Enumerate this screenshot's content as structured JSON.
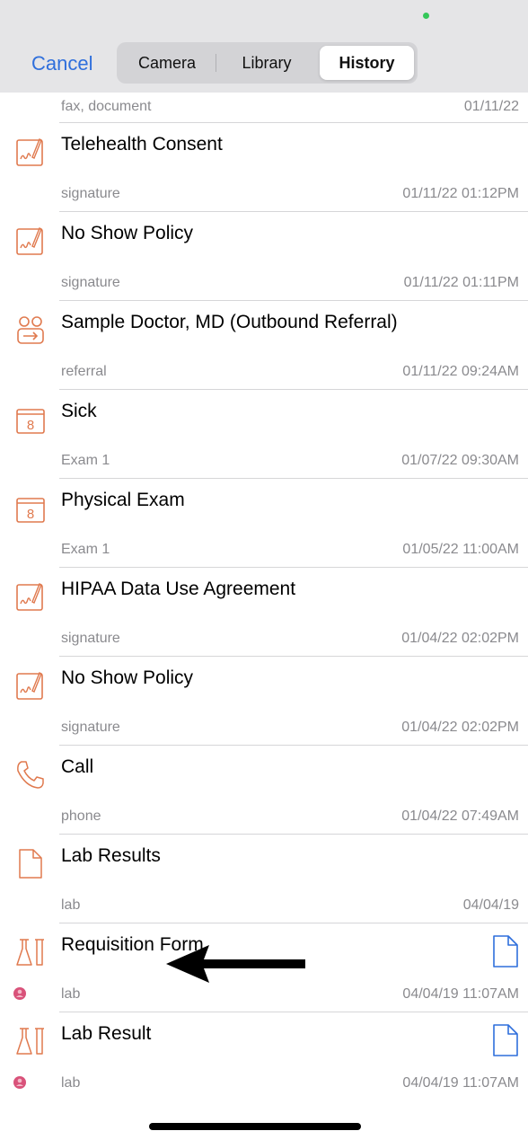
{
  "header": {
    "cancel_label": "Cancel",
    "tabs": [
      {
        "label": "Camera",
        "selected": false
      },
      {
        "label": "Library",
        "selected": false
      },
      {
        "label": "History",
        "selected": true
      }
    ]
  },
  "top_partial": {
    "subtitle": "fax, document",
    "date": "01/11/22"
  },
  "items": [
    {
      "title": "Telehealth Consent",
      "subtitle": "signature",
      "date": "01/11/22 01:12PM",
      "icon": "signature-icon"
    },
    {
      "title": "No Show Policy",
      "subtitle": "signature",
      "date": "01/11/22 01:11PM",
      "icon": "signature-icon"
    },
    {
      "title": "Sample Doctor, MD (Outbound Referral)",
      "subtitle": "referral",
      "date": "01/11/22 09:24AM",
      "icon": "referral-icon"
    },
    {
      "title": "Sick",
      "subtitle": "Exam 1",
      "date": "01/07/22 09:30AM",
      "icon": "calendar-icon",
      "calendar_day": "8"
    },
    {
      "title": "Physical Exam",
      "subtitle": "Exam 1",
      "date": "01/05/22 11:00AM",
      "icon": "calendar-icon",
      "calendar_day": "8"
    },
    {
      "title": "HIPAA Data Use Agreement",
      "subtitle": "signature",
      "date": "01/04/22 02:02PM",
      "icon": "signature-icon"
    },
    {
      "title": "No Show Policy",
      "subtitle": "signature",
      "date": "01/04/22 02:02PM",
      "icon": "signature-icon"
    },
    {
      "title": "Call",
      "subtitle": "phone",
      "date": "01/04/22 07:49AM",
      "icon": "phone-icon"
    },
    {
      "title": "Lab Results",
      "subtitle": "lab",
      "date": "04/04/19",
      "icon": "document-icon"
    },
    {
      "title": "Requisition Form",
      "subtitle": "lab",
      "date": "04/04/19 11:07AM",
      "icon": "lab-flask-icon"
    },
    {
      "title": "Lab Result",
      "subtitle": "lab",
      "date": "04/04/19 11:07AM",
      "icon": "lab-flask-icon"
    }
  ],
  "colors": {
    "accent_blue": "#2f6fdc",
    "icon_orange": "#e07a4f",
    "badge_pink": "#d9527a",
    "status_green": "#34c759"
  }
}
